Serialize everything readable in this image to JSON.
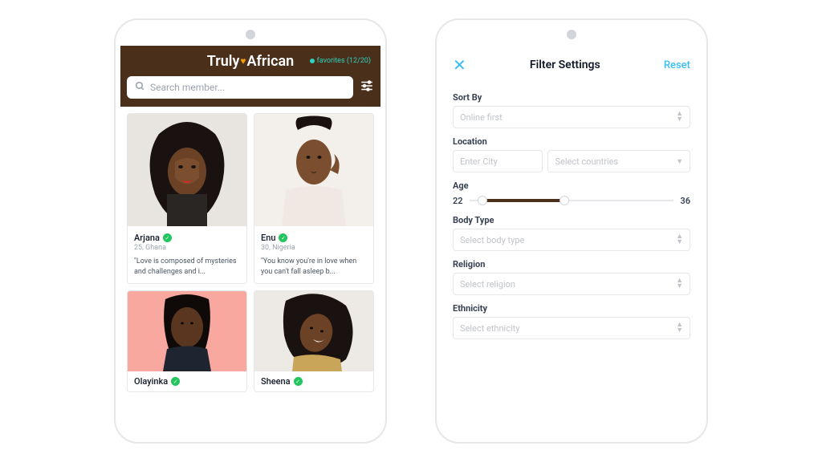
{
  "left": {
    "brand": {
      "pre": "Truly",
      "post": "African"
    },
    "favorites": "favorites (12/20)",
    "search_placeholder": "Search member...",
    "cards": [
      {
        "name": "Arjana",
        "meta": "25, Ghana",
        "quote": "\"Love is composed of mysteries and challenges and i..."
      },
      {
        "name": "Enu",
        "meta": "30, Nigeria",
        "quote": "\"You know you're in love when you can't fall asleep b..."
      },
      {
        "name": "Olayinka",
        "meta": "",
        "quote": ""
      },
      {
        "name": "Sheena",
        "meta": "",
        "quote": ""
      }
    ]
  },
  "right": {
    "title": "Filter Settings",
    "reset": "Reset",
    "sort": {
      "label": "Sort By",
      "value": "Online first"
    },
    "location": {
      "label": "Location",
      "city": "Enter City",
      "countries": "Select countries"
    },
    "age": {
      "label": "Age",
      "min": "22",
      "max": "36"
    },
    "body": {
      "label": "Body Type",
      "value": "Select body type"
    },
    "religion": {
      "label": "Religion",
      "value": "Select religion"
    },
    "ethnicity": {
      "label": "Ethnicity",
      "value": "Select ethnicity"
    }
  }
}
